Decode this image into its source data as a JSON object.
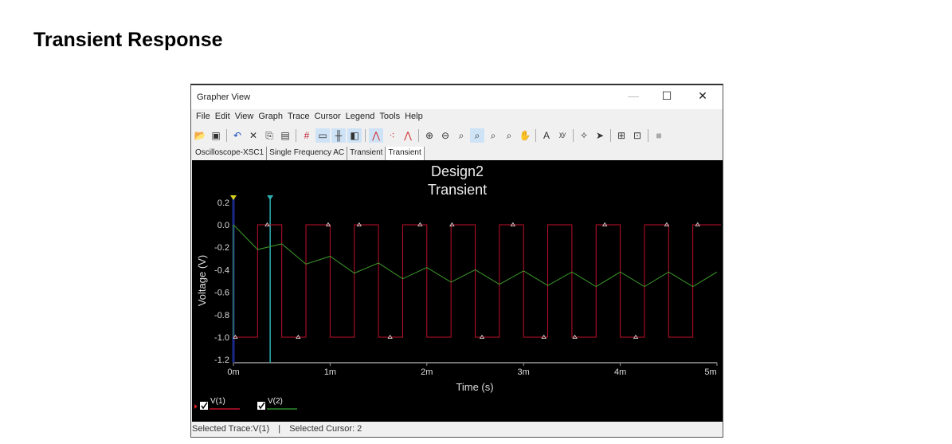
{
  "page": {
    "heading": "Transient Response"
  },
  "window": {
    "title": "Grapher View",
    "minimize": "—",
    "maximize": "☐",
    "close": "✕"
  },
  "menu": [
    "File",
    "Edit",
    "View",
    "Graph",
    "Trace",
    "Cursor",
    "Legend",
    "Tools",
    "Help"
  ],
  "toolbar": [
    {
      "icon": "open-icon",
      "glyph": "📂"
    },
    {
      "icon": "save-icon",
      "glyph": "▣"
    },
    {
      "sep": true
    },
    {
      "icon": "undo-icon",
      "glyph": "↶"
    },
    {
      "icon": "delete-icon",
      "glyph": "✕"
    },
    {
      "icon": "copy-icon",
      "glyph": "⎘"
    },
    {
      "icon": "paste-icon",
      "glyph": "▤"
    },
    {
      "sep": true
    },
    {
      "icon": "grid-icon",
      "glyph": "#",
      "on": false
    },
    {
      "icon": "legend-icon",
      "glyph": "▭",
      "on": true
    },
    {
      "icon": "cursors-icon",
      "glyph": "╫",
      "on": true
    },
    {
      "icon": "reverse-colors-icon",
      "glyph": "◧",
      "on": true
    },
    {
      "sep": true
    },
    {
      "icon": "show-lines-icon",
      "glyph": "⋀",
      "on": true
    },
    {
      "icon": "show-points-icon",
      "glyph": "⁖"
    },
    {
      "icon": "lines-points-icon",
      "glyph": "⋀"
    },
    {
      "sep": true
    },
    {
      "icon": "zoom-in-icon",
      "glyph": "⊕"
    },
    {
      "icon": "zoom-out-icon",
      "glyph": "⊖"
    },
    {
      "icon": "zoom-area-icon",
      "glyph": "⌕"
    },
    {
      "icon": "zoom-full-icon",
      "glyph": "⌕",
      "on": true
    },
    {
      "icon": "zoom-x-icon",
      "glyph": "⌕"
    },
    {
      "icon": "zoom-y-icon",
      "glyph": "⌕"
    },
    {
      "icon": "pan-icon",
      "glyph": "✋"
    },
    {
      "sep": true
    },
    {
      "icon": "text-icon",
      "glyph": "A"
    },
    {
      "icon": "label-icon",
      "glyph": "ᵡʸ"
    },
    {
      "sep": true
    },
    {
      "icon": "trace-icon",
      "glyph": "✧"
    },
    {
      "icon": "export-icon",
      "glyph": "➤"
    },
    {
      "sep": true
    },
    {
      "icon": "overlay-icon",
      "glyph": "⊞"
    },
    {
      "icon": "merge-icon",
      "glyph": "⊡"
    },
    {
      "sep": true
    },
    {
      "icon": "stop-icon",
      "glyph": "■"
    }
  ],
  "tabs": [
    {
      "label": "Oscilloscope-XSC1"
    },
    {
      "label": "Single Frequency AC"
    },
    {
      "label": "Transient"
    },
    {
      "label": "Transient",
      "active": true
    }
  ],
  "status": {
    "trace": "Selected Trace:V(1)",
    "divider": "|",
    "cursor": "Selected Cursor: 2"
  },
  "chart_data": {
    "type": "line",
    "title": "Design2",
    "subtitle": "Transient",
    "xlabel": "Time (s)",
    "ylabel": "Voltage (V)",
    "xlim": [
      0,
      5
    ],
    "ylim": [
      -1.27,
      0.27
    ],
    "xticks": [
      {
        "v": 0,
        "label": "0m"
      },
      {
        "v": 1,
        "label": "1m"
      },
      {
        "v": 2,
        "label": "2m"
      },
      {
        "v": 3,
        "label": "3m"
      },
      {
        "v": 4,
        "label": "4m"
      },
      {
        "v": 5,
        "label": "5m"
      }
    ],
    "yticks": [
      {
        "v": 0.2,
        "label": "0.2"
      },
      {
        "v": 0,
        "label": "0.0"
      },
      {
        "v": -0.2,
        "label": "-0.2"
      },
      {
        "v": -0.4,
        "label": "-0.4"
      },
      {
        "v": -0.6,
        "label": "-0.6"
      },
      {
        "v": -0.8,
        "label": "-0.8"
      },
      {
        "v": -1.0,
        "label": "-1.0"
      },
      {
        "v": -1.2,
        "label": "-1.2"
      }
    ],
    "x_units": "ms",
    "series": [
      {
        "name": "V(1)",
        "color": "#c0102a",
        "step": true,
        "x": [
          0,
          0.25,
          0.5,
          0.75,
          1.0,
          1.25,
          1.5,
          1.75,
          2.0,
          2.25,
          2.5,
          2.75,
          3.0,
          3.25,
          3.5,
          3.75,
          4.0,
          4.25,
          4.5,
          4.75,
          5.0
        ],
        "y": [
          -1,
          0,
          -1,
          0,
          -1,
          0,
          -1,
          0,
          -1,
          0,
          -1,
          0,
          -1,
          0,
          -1,
          0,
          -1,
          0,
          -1,
          0,
          0
        ],
        "markers_high": [
          0.35,
          0.98,
          1.3,
          1.93,
          2.26,
          2.89,
          3.84,
          4.48,
          4.8
        ],
        "markers_low": [
          0.02,
          0.67,
          1.62,
          2.57,
          3.21,
          3.53,
          4.16
        ]
      },
      {
        "name": "V(2)",
        "color": "#3c9a2a",
        "x": [
          0,
          0.25,
          0.5,
          0.75,
          1.0,
          1.25,
          1.5,
          1.75,
          2.0,
          2.25,
          2.5,
          2.75,
          3.0,
          3.25,
          3.5,
          3.75,
          4.0,
          4.25,
          4.5,
          4.75,
          5.0
        ],
        "y": [
          0,
          -0.22,
          -0.17,
          -0.35,
          -0.28,
          -0.43,
          -0.34,
          -0.48,
          -0.38,
          -0.51,
          -0.4,
          -0.53,
          -0.41,
          -0.54,
          -0.42,
          -0.55,
          -0.42,
          -0.55,
          -0.42,
          -0.55,
          -0.42
        ]
      }
    ],
    "cursors": [
      {
        "name": "1",
        "x": 0,
        "color": "#d8d020"
      },
      {
        "name": "2",
        "x": 0.38,
        "color": "#2fb0b0"
      }
    ],
    "legend": [
      {
        "label": "V(1)",
        "color": "#c0102a",
        "checked": true
      },
      {
        "label": "V(2)",
        "color": "#2a8a2a",
        "checked": true
      }
    ],
    "legend_position": "bottom-left"
  }
}
